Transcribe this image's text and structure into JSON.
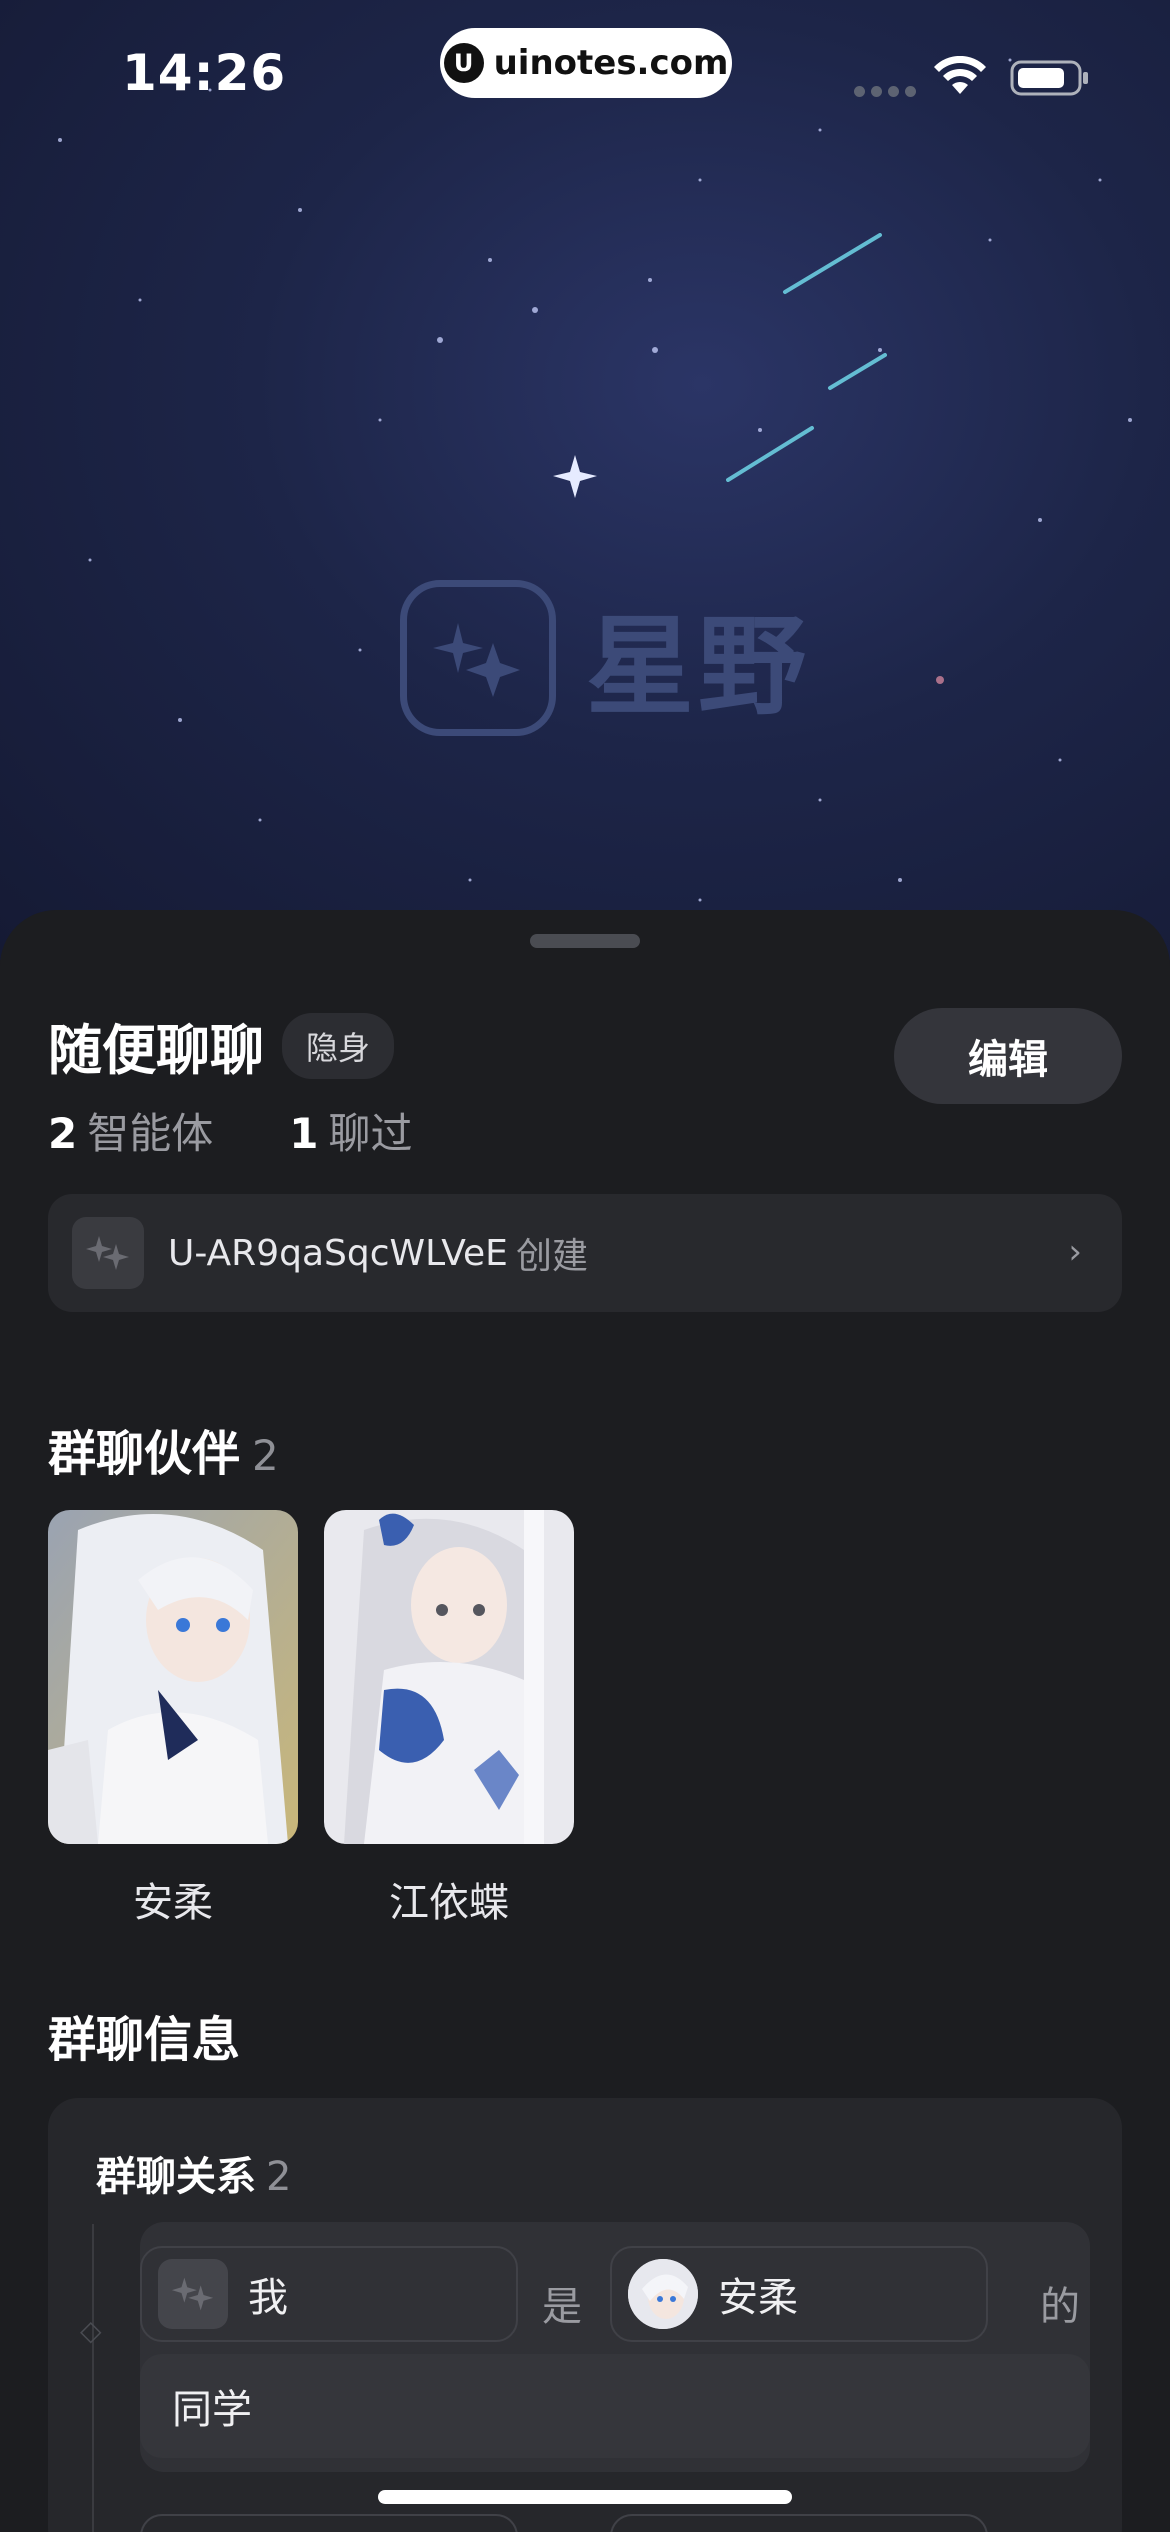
{
  "status_bar": {
    "time": "14:26",
    "url": "uinotes.com"
  },
  "hero": {
    "brand_name": "星野"
  },
  "group": {
    "title": "随便聊聊",
    "badge": "隐身",
    "edit_label": "编辑",
    "stats": [
      {
        "num": "2",
        "label": "智能体"
      },
      {
        "num": "1",
        "label": "聊过"
      }
    ],
    "creator_id": "U-AR9qaSqcWLVeE",
    "creator_suffix": "创建"
  },
  "partners": {
    "title": "群聊伙伴",
    "count": "2",
    "members": [
      {
        "name": "安柔"
      },
      {
        "name": "江依蝶"
      }
    ]
  },
  "info": {
    "title": "群聊信息",
    "relations_title": "群聊关系",
    "relations_count": "2",
    "relation": {
      "subject": "我",
      "is": "是",
      "object": "安柔",
      "of": "的",
      "value": "同学"
    }
  },
  "colors": {
    "background": "#1b1c1f",
    "sky": "#1d2548",
    "card": "#28292d",
    "accent_blue": "#3a5fb0"
  }
}
